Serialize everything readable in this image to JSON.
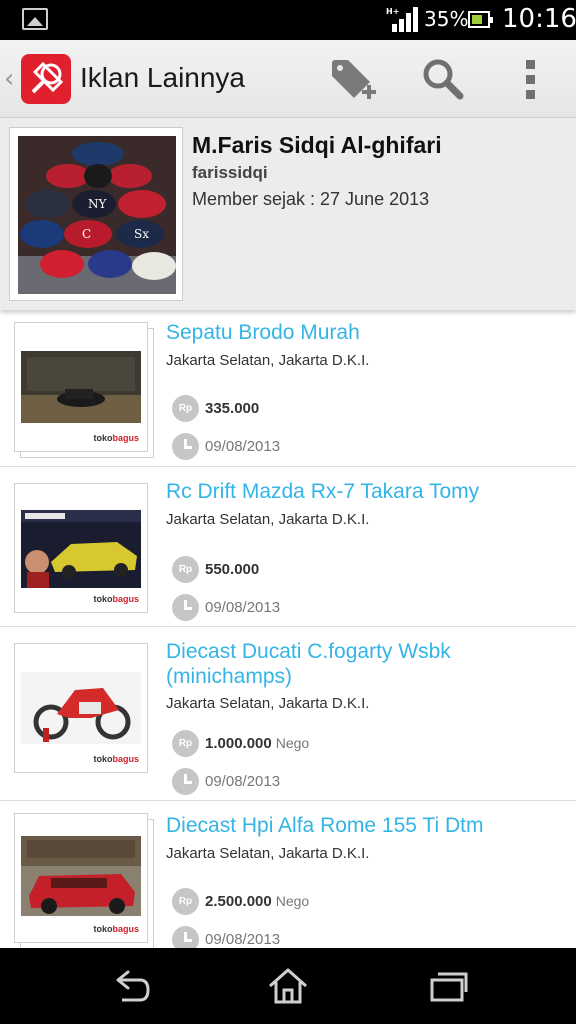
{
  "status_bar": {
    "network_label": "H+",
    "battery_percent": "35%",
    "time": "10:16",
    "battery_fill_fraction": 0.35,
    "icons": [
      "picture-icon",
      "signal-icon",
      "battery-icon"
    ]
  },
  "app_bar": {
    "title": "Iklan Lainnya",
    "icons": [
      "app-logo-icon",
      "add-tag-icon",
      "search-icon",
      "overflow-menu-icon"
    ],
    "brand_color": "#e1202e"
  },
  "profile": {
    "name": "M.Faris Sidqi Al-ghifari",
    "username": "farissidqi",
    "member_since": "Member sejak : 27 June 2013"
  },
  "listings": [
    {
      "title": "Sepatu Brodo Murah",
      "location": "Jakarta Selatan, Jakarta D.K.I.",
      "currency": "Rp",
      "price": "335.000",
      "nego": "",
      "date": "09/08/2013",
      "stacked": true
    },
    {
      "title": "Rc Drift Mazda Rx-7 Takara Tomy",
      "location": "Jakarta Selatan, Jakarta D.K.I.",
      "currency": "Rp",
      "price": "550.000",
      "nego": "",
      "date": "09/08/2013",
      "stacked": false
    },
    {
      "title": "Diecast Ducati C.fogarty Wsbk (minichamps)",
      "location": "Jakarta Selatan, Jakarta D.K.I.",
      "currency": "Rp",
      "price": "1.000.000",
      "nego": "Nego",
      "date": "09/08/2013",
      "stacked": false
    },
    {
      "title": "Diecast Hpi Alfa Rome 155 Ti Dtm",
      "location": "Jakarta Selatan, Jakarta D.K.I.",
      "currency": "Rp",
      "price": "2.500.000",
      "nego": "Nego",
      "date": "09/08/2013",
      "stacked": true
    }
  ],
  "watermark": {
    "prefix": "toko",
    "suffix": "bagus"
  },
  "nav_bar": {
    "icons": [
      "back-icon",
      "home-icon",
      "recent-apps-icon"
    ]
  },
  "colors": {
    "title_link": "#33b5e5",
    "badge": "#c6c6c6"
  }
}
